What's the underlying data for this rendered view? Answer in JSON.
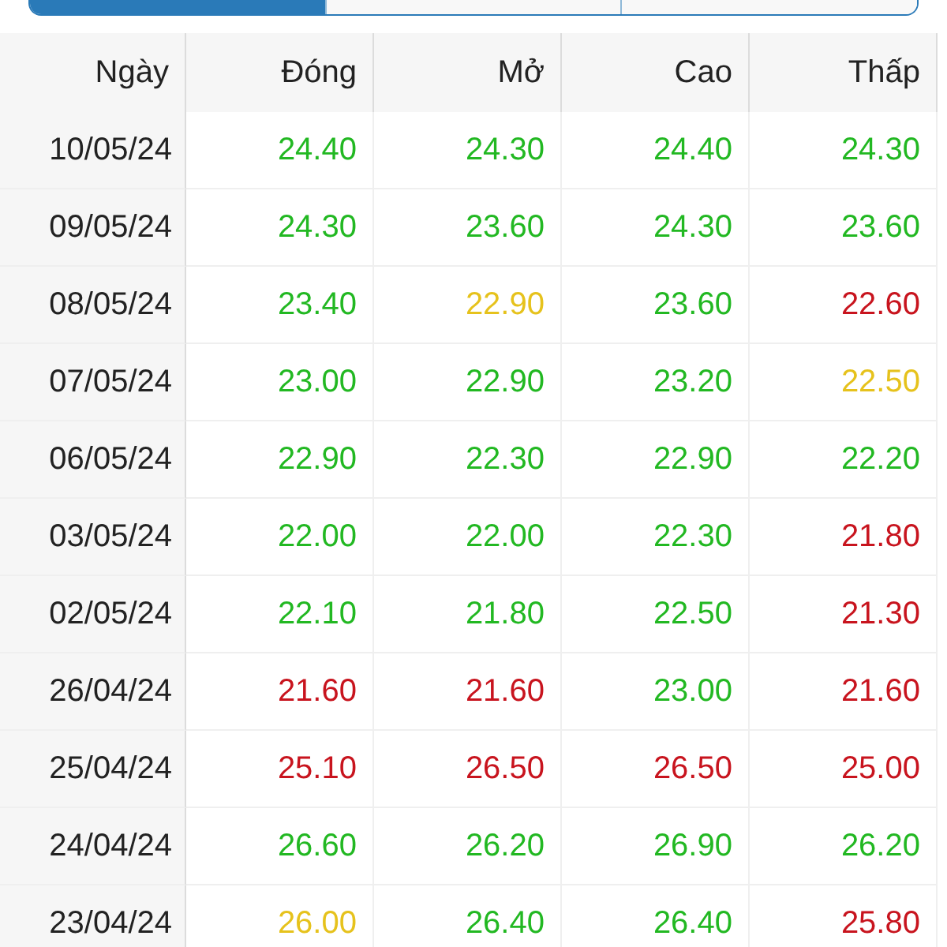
{
  "segments": [
    {
      "selected": true
    },
    {
      "selected": false
    },
    {
      "selected": false
    }
  ],
  "table": {
    "columns": [
      "Ngày",
      "Đóng",
      "Mở",
      "Cao",
      "Thấp"
    ],
    "rows": [
      {
        "cells": [
          {
            "value": "10/05/24"
          },
          {
            "value": "24.40",
            "color": "#22b822"
          },
          {
            "value": "24.30",
            "color": "#22b822"
          },
          {
            "value": "24.40",
            "color": "#22b822"
          },
          {
            "value": "24.30",
            "color": "#22b822"
          }
        ]
      },
      {
        "cells": [
          {
            "value": "09/05/24"
          },
          {
            "value": "24.30",
            "color": "#22b822"
          },
          {
            "value": "23.60",
            "color": "#22b822"
          },
          {
            "value": "24.30",
            "color": "#22b822"
          },
          {
            "value": "23.60",
            "color": "#22b822"
          }
        ]
      },
      {
        "cells": [
          {
            "value": "08/05/24"
          },
          {
            "value": "23.40",
            "color": "#22b822"
          },
          {
            "value": "22.90",
            "color": "#e6c21c"
          },
          {
            "value": "23.60",
            "color": "#22b822"
          },
          {
            "value": "22.60",
            "color": "#c8141e"
          }
        ]
      },
      {
        "cells": [
          {
            "value": "07/05/24"
          },
          {
            "value": "23.00",
            "color": "#22b822"
          },
          {
            "value": "22.90",
            "color": "#22b822"
          },
          {
            "value": "23.20",
            "color": "#22b822"
          },
          {
            "value": "22.50",
            "color": "#e6c21c"
          }
        ]
      },
      {
        "cells": [
          {
            "value": "06/05/24"
          },
          {
            "value": "22.90",
            "color": "#22b822"
          },
          {
            "value": "22.30",
            "color": "#22b822"
          },
          {
            "value": "22.90",
            "color": "#22b822"
          },
          {
            "value": "22.20",
            "color": "#22b822"
          }
        ]
      },
      {
        "cells": [
          {
            "value": "03/05/24"
          },
          {
            "value": "22.00",
            "color": "#22b822"
          },
          {
            "value": "22.00",
            "color": "#22b822"
          },
          {
            "value": "22.30",
            "color": "#22b822"
          },
          {
            "value": "21.80",
            "color": "#c8141e"
          }
        ]
      },
      {
        "cells": [
          {
            "value": "02/05/24"
          },
          {
            "value": "22.10",
            "color": "#22b822"
          },
          {
            "value": "21.80",
            "color": "#22b822"
          },
          {
            "value": "22.50",
            "color": "#22b822"
          },
          {
            "value": "21.30",
            "color": "#c8141e"
          }
        ]
      },
      {
        "cells": [
          {
            "value": "26/04/24"
          },
          {
            "value": "21.60",
            "color": "#c8141e"
          },
          {
            "value": "21.60",
            "color": "#c8141e"
          },
          {
            "value": "23.00",
            "color": "#22b822"
          },
          {
            "value": "21.60",
            "color": "#c8141e"
          }
        ]
      },
      {
        "cells": [
          {
            "value": "25/04/24"
          },
          {
            "value": "25.10",
            "color": "#c8141e"
          },
          {
            "value": "26.50",
            "color": "#c8141e"
          },
          {
            "value": "26.50",
            "color": "#c8141e"
          },
          {
            "value": "25.00",
            "color": "#c8141e"
          }
        ]
      },
      {
        "cells": [
          {
            "value": "24/04/24"
          },
          {
            "value": "26.60",
            "color": "#22b822"
          },
          {
            "value": "26.20",
            "color": "#22b822"
          },
          {
            "value": "26.90",
            "color": "#22b822"
          },
          {
            "value": "26.20",
            "color": "#22b822"
          }
        ]
      },
      {
        "cells": [
          {
            "value": "23/04/24"
          },
          {
            "value": "26.00",
            "color": "#e6c21c"
          },
          {
            "value": "26.40",
            "color": "#22b822"
          },
          {
            "value": "26.40",
            "color": "#22b822"
          },
          {
            "value": "25.80",
            "color": "#c8141e"
          }
        ]
      }
    ]
  }
}
